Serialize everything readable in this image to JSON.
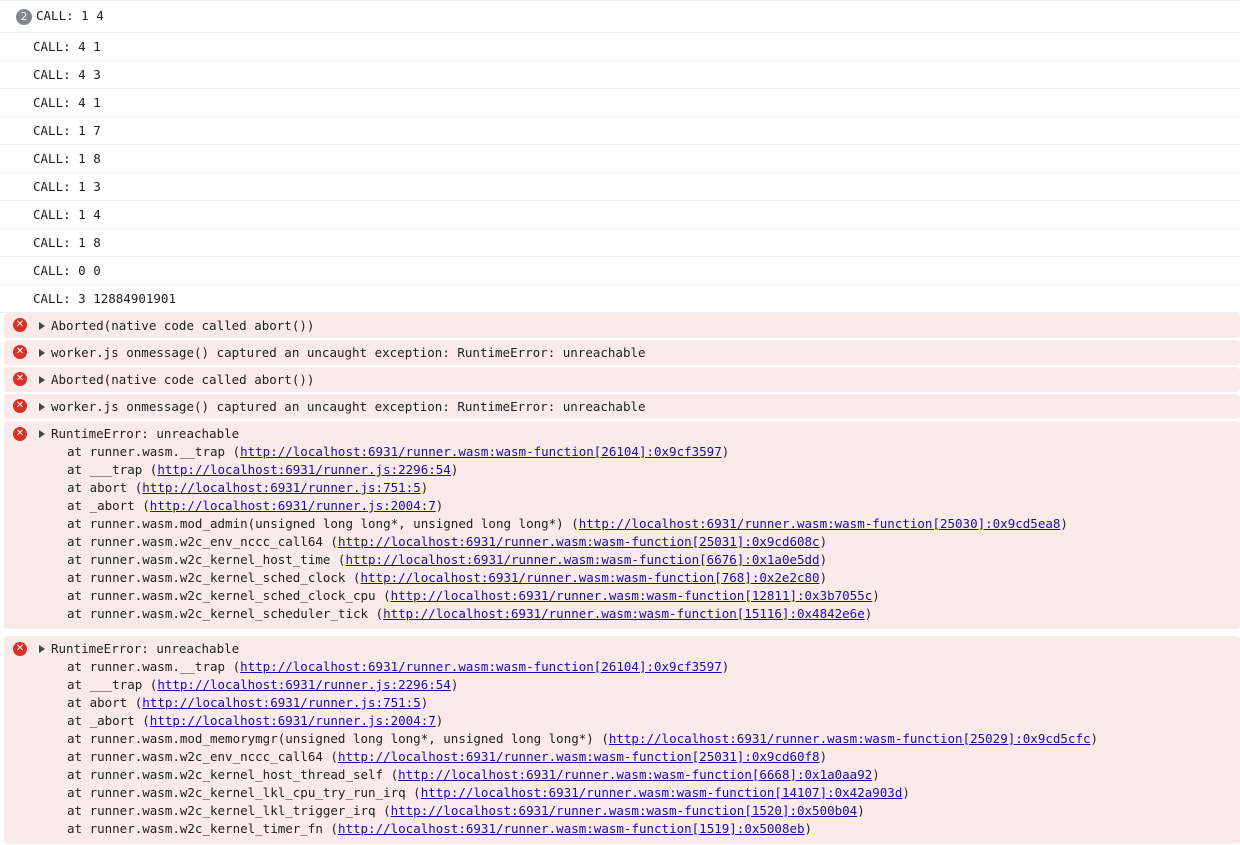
{
  "logs": [
    {
      "badge": "2",
      "text": "CALL: 1 4"
    },
    {
      "text": "CALL: 4 1"
    },
    {
      "text": "CALL: 4 3"
    },
    {
      "text": "CALL: 4 1"
    },
    {
      "text": "CALL: 1 7"
    },
    {
      "text": "CALL: 1 8"
    },
    {
      "text": "CALL: 1 3"
    },
    {
      "text": "CALL: 1 4"
    },
    {
      "text": "CALL: 1 8"
    },
    {
      "text": "CALL: 0 0"
    },
    {
      "text": "CALL: 3 12884901901"
    }
  ],
  "errors": [
    "Aborted(native code called abort())",
    "worker.js onmessage() captured an uncaught exception: RuntimeError: unreachable",
    "Aborted(native code called abort())",
    "worker.js onmessage() captured an uncaught exception: RuntimeError: unreachable"
  ],
  "stack1": {
    "title": "RuntimeError: unreachable",
    "frames": [
      {
        "pre": "at runner.wasm.__trap (",
        "url": "http://localhost:6931/runner.wasm:wasm-function[26104]:0x9cf3597",
        "post": ")"
      },
      {
        "pre": "at ___trap (",
        "url": "http://localhost:6931/runner.js:2296:54",
        "post": ")"
      },
      {
        "pre": "at abort (",
        "url": "http://localhost:6931/runner.js:751:5",
        "post": ")"
      },
      {
        "pre": "at _abort (",
        "url": "http://localhost:6931/runner.js:2004:7",
        "post": ")"
      },
      {
        "pre": "at runner.wasm.mod_admin(unsigned long long*, unsigned long long*) (",
        "url": "http://localhost:6931/runner.wasm:wasm-function[25030]:0x9cd5ea8",
        "post": ")"
      },
      {
        "pre": "at runner.wasm.w2c_env_nccc_call64 (",
        "url": "http://localhost:6931/runner.wasm:wasm-function[25031]:0x9cd608c",
        "post": ")"
      },
      {
        "pre": "at runner.wasm.w2c_kernel_host_time (",
        "url": "http://localhost:6931/runner.wasm:wasm-function[6676]:0x1a0e5dd",
        "post": ")"
      },
      {
        "pre": "at runner.wasm.w2c_kernel_sched_clock (",
        "url": "http://localhost:6931/runner.wasm:wasm-function[768]:0x2e2c80",
        "post": ")"
      },
      {
        "pre": "at runner.wasm.w2c_kernel_sched_clock_cpu (",
        "url": "http://localhost:6931/runner.wasm:wasm-function[12811]:0x3b7055c",
        "post": ")"
      },
      {
        "pre": "at runner.wasm.w2c_kernel_scheduler_tick (",
        "url": "http://localhost:6931/runner.wasm:wasm-function[15116]:0x4842e6e",
        "post": ")"
      }
    ]
  },
  "stack2": {
    "title": "RuntimeError: unreachable",
    "frames": [
      {
        "pre": "at runner.wasm.__trap (",
        "url": "http://localhost:6931/runner.wasm:wasm-function[26104]:0x9cf3597",
        "post": ")"
      },
      {
        "pre": "at ___trap (",
        "url": "http://localhost:6931/runner.js:2296:54",
        "post": ")"
      },
      {
        "pre": "at abort (",
        "url": "http://localhost:6931/runner.js:751:5",
        "post": ")"
      },
      {
        "pre": "at _abort (",
        "url": "http://localhost:6931/runner.js:2004:7",
        "post": ")"
      },
      {
        "pre": "at runner.wasm.mod_memorymgr(unsigned long long*, unsigned long long*) (",
        "url": "http://localhost:6931/runner.wasm:wasm-function[25029]:0x9cd5cfc",
        "post": ")"
      },
      {
        "pre": "at runner.wasm.w2c_env_nccc_call64 (",
        "url": "http://localhost:6931/runner.wasm:wasm-function[25031]:0x9cd60f8",
        "post": ")"
      },
      {
        "pre": "at runner.wasm.w2c_kernel_host_thread_self (",
        "url": "http://localhost:6931/runner.wasm:wasm-function[6668]:0x1a0aa92",
        "post": ")"
      },
      {
        "pre": "at runner.wasm.w2c_kernel_lkl_cpu_try_run_irq (",
        "url": "http://localhost:6931/runner.wasm:wasm-function[14107]:0x42a903d",
        "post": ")"
      },
      {
        "pre": "at runner.wasm.w2c_kernel_lkl_trigger_irq (",
        "url": "http://localhost:6931/runner.wasm:wasm-function[1520]:0x500b04",
        "post": ")"
      },
      {
        "pre": "at runner.wasm.w2c_kernel_timer_fn (",
        "url": "http://localhost:6931/runner.wasm:wasm-function[1519]:0x5008eb",
        "post": ")"
      }
    ]
  },
  "icons": {
    "error": "error-x-icon",
    "expand": "expand-triangle-icon"
  }
}
